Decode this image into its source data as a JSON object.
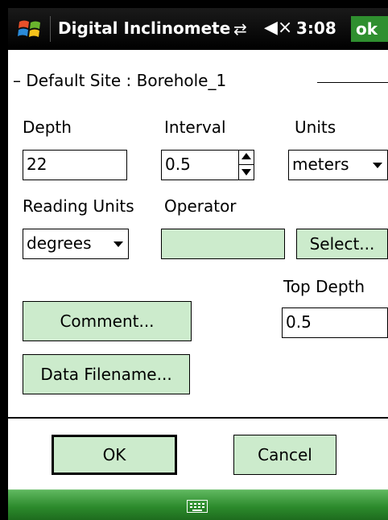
{
  "titlebar": {
    "title": "Digital Inclinomete",
    "time": "3:08",
    "ok_label": "ok"
  },
  "site": {
    "label": "– Default Site : Borehole_1"
  },
  "form": {
    "depth_label": "Depth",
    "depth_value": "22",
    "interval_label": "Interval",
    "interval_value": "0.5",
    "units_label": "Units",
    "units_value": "meters",
    "reading_units_label": "Reading Units",
    "reading_units_value": "degrees",
    "operator_label": "Operator",
    "operator_value": "",
    "select_label": "Select...",
    "top_depth_label": "Top Depth",
    "top_depth_value": "0.5",
    "comment_label": "Comment...",
    "data_filename_label": "Data Filename..."
  },
  "dialog": {
    "ok_label": "OK",
    "cancel_label": "Cancel"
  },
  "colors": {
    "button_fill": "#ccebcc",
    "softbar": "#2c8a2c",
    "ok_badge": "#2f8f2f"
  },
  "icons": [
    "windows-start-icon",
    "connectivity-icon",
    "speaker-muted-icon",
    "keyboard-icon"
  ]
}
